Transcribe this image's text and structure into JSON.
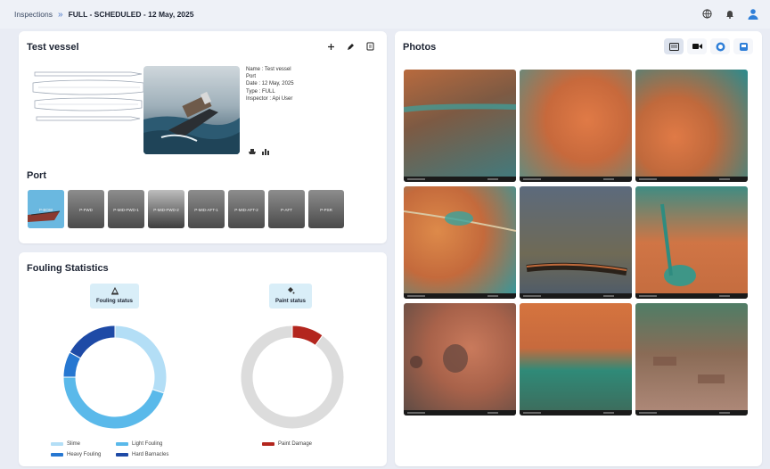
{
  "breadcrumb": {
    "root": "Inspections",
    "current": "FULL - SCHEDULED - 12 May, 2025"
  },
  "vessel_card": {
    "title": "Test vessel",
    "info": [
      "Name : Test vessel",
      "Port",
      "Date : 12 May, 2025",
      "Type : FULL",
      "Inspector : Api User"
    ],
    "section_label": "Port",
    "thumbnails": [
      "P-BOW",
      "P-FWD",
      "P-MID-FWD-1",
      "P-MID-FWD-2",
      "P-MID-AFT-1",
      "P-MID-AFT-2",
      "P-AFT",
      "P-PSR"
    ]
  },
  "fouling": {
    "title": "Fouling Statistics",
    "fouling_status_label": "Fouling status",
    "paint_status_label": "Paint status",
    "fouling_chart": {
      "type": "pie",
      "slices": [
        {
          "label": "Slime",
          "value": 0.3,
          "color": "#b3def6"
        },
        {
          "label": "Light Fouling",
          "value": 0.45,
          "color": "#5ab9ea"
        },
        {
          "label": "Heavy Fouling",
          "value": 0.08,
          "color": "#2677d1"
        },
        {
          "label": "Hard Barnacles",
          "value": 0.17,
          "color": "#1e4aa6"
        }
      ]
    },
    "paint_chart": {
      "type": "pie",
      "slices": [
        {
          "label": "Paint Damage",
          "value": 0.1,
          "color": "#b3261e"
        },
        {
          "label": "",
          "value": 0.9,
          "color": "#dcdcdc"
        }
      ]
    },
    "legend_fouling": [
      "Slime",
      "Light Fouling",
      "Heavy Fouling",
      "Hard Barnacles"
    ],
    "legend_paint": [
      "Paint Damage"
    ]
  },
  "photos": {
    "title": "Photos",
    "tools": [
      "gallery-icon",
      "video-icon",
      "scan-icon",
      "device-icon"
    ]
  },
  "colors": {
    "accent": "#2f7fd8",
    "paint_damage": "#b3261e"
  }
}
